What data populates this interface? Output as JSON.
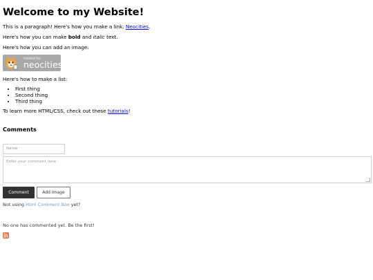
{
  "heading": "Welcome to my Website!",
  "para1": {
    "text": "This is a paragraph! Here's how you make a link: ",
    "link": "Neocities",
    "end": "."
  },
  "para2": {
    "before": "Here's how you can make ",
    "bold": "bold",
    "mid": " and ",
    "italic": "italic",
    "after": " text."
  },
  "para3": "Here's how you can add an image:",
  "badge": {
    "small_text": "hosted by",
    "big_text": "neocities",
    "color": "#a8a8a8"
  },
  "para4": "Here's how to make a list:",
  "list": [
    "First thing",
    "Second thing",
    "Third thing"
  ],
  "para5": {
    "before": "To learn more HTML/CSS, check out these ",
    "link": "tutorials",
    "after": "!"
  },
  "comments": {
    "heading": "Comments",
    "name_placeholder": "Name",
    "comment_placeholder": "Enter your comment here",
    "comment_button": "Comment",
    "add_image_button": "Add Image",
    "not_using_before": "Not using ",
    "not_using_link": "Html Comment Box",
    "not_using_after": "  yet?",
    "empty_message": "No one has commented yet. Be the first!",
    "rss_icon": "rss-feed-icon",
    "rss_color": "#e8784a"
  },
  "colors": {
    "link": "#0000ee",
    "button_dark": "#333333",
    "commentbox_link": "#6fa0c8"
  }
}
